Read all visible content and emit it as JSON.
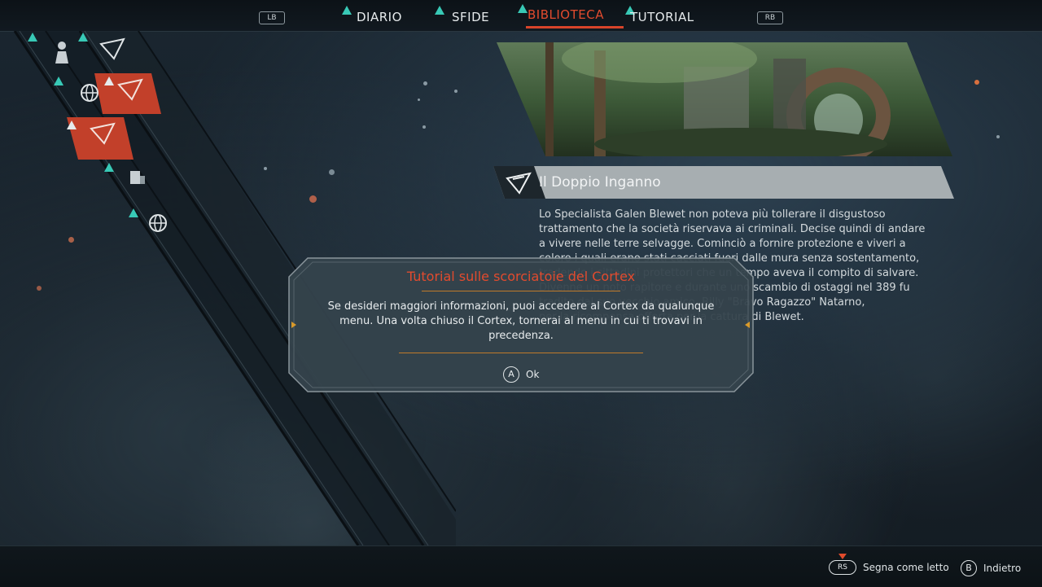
{
  "nav": {
    "left_bumper": "LB",
    "right_bumper": "RB",
    "tabs": [
      {
        "label": "DIARIO",
        "active": false
      },
      {
        "label": "SFIDE",
        "active": false
      },
      {
        "label": "BIBLIOTECA",
        "active": true
      },
      {
        "label": "TUTORIAL",
        "active": false
      }
    ]
  },
  "entry": {
    "title": "Il Doppio Inganno",
    "icon": "javelin-glyph-icon",
    "body": [
      "Lo Specialista Galen Blewet non poteva più tollerare il disgustoso",
      "trattamento che la società riservava ai criminali. Decise quindi di andare",
      "a vivere nelle terre selvagge. Cominciò a fornire protezione e viveri a",
      "coloro i quali erano stati cacciati fuori dalle mura senza sostentamento,",
      "tradendo i cittadini protettori che un tempo aveva il compito di salvare.",
      "Divenne un noto rapitore e durante uno scambio di ostaggi nel 389 fu",
      "tradito dal suo vecchio amico, Billy \"Bravo Ragazzo\" Natarno,",
      "per la ricompensa offerta per la cattura di Blewet."
    ]
  },
  "dialog": {
    "title": "Tutorial sulle scorciatoie del Cortex",
    "message": "Se desideri maggiori informazioni, puoi accedere al Cortex da qualunque menu. Una volta chiuso il Cortex, tornerai al menu in cui ti trovavi in precedenza.",
    "confirm_button": "A",
    "confirm_label": "Ok"
  },
  "footer": {
    "mark_read_button": "RS",
    "mark_read_label": "Segna come letto",
    "back_button": "B",
    "back_label": "Indietro"
  },
  "colors": {
    "accent": "#e24b2e",
    "new_marker": "#38c9b6",
    "dialog_border": "#8a959b",
    "dialog_bg": "#35434c",
    "selected_row": "#c2402a"
  }
}
